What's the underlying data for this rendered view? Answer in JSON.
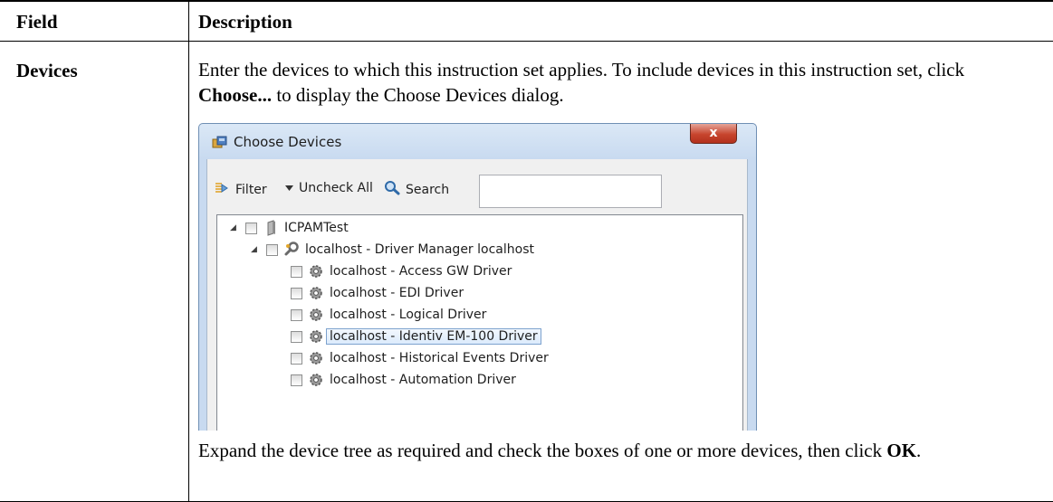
{
  "table": {
    "headers": {
      "field": "Field",
      "description": "Description"
    },
    "row": {
      "field": "Devices",
      "para1_a": "Enter the devices to which this instruction set applies. To include devices in this instruction set, click ",
      "para1_bold": "Choose...",
      "para1_b": " to display the Choose Devices dialog.",
      "para2_a": "Expand the device tree as required and check the boxes of one or more devices, then click ",
      "para2_bold": "OK",
      "para2_b": "."
    }
  },
  "dialog": {
    "title": "Choose Devices",
    "close_label": "x",
    "toolbar": {
      "filter_label": "Filter",
      "uncheck_all_label": "Uncheck All",
      "search_label": "Search",
      "search_value": ""
    },
    "tree": {
      "root": "ICPAMTest",
      "manager": "localhost - Driver Manager localhost",
      "drivers": [
        "localhost - Access GW Driver",
        "localhost - EDI Driver",
        "localhost - Logical Driver",
        "localhost - Identiv EM-100 Driver",
        "localhost - Historical Events Driver",
        "localhost - Automation Driver"
      ],
      "selected": "localhost - Identiv EM-100 Driver"
    }
  },
  "icons": {
    "title": "devices-dialog-icon",
    "filter": "filter-icon",
    "uncheck": "dropdown-arrow-icon",
    "search": "magnifier-icon",
    "root": "server-icon",
    "manager": "driver-manager-icon",
    "driver": "gear-icon"
  }
}
